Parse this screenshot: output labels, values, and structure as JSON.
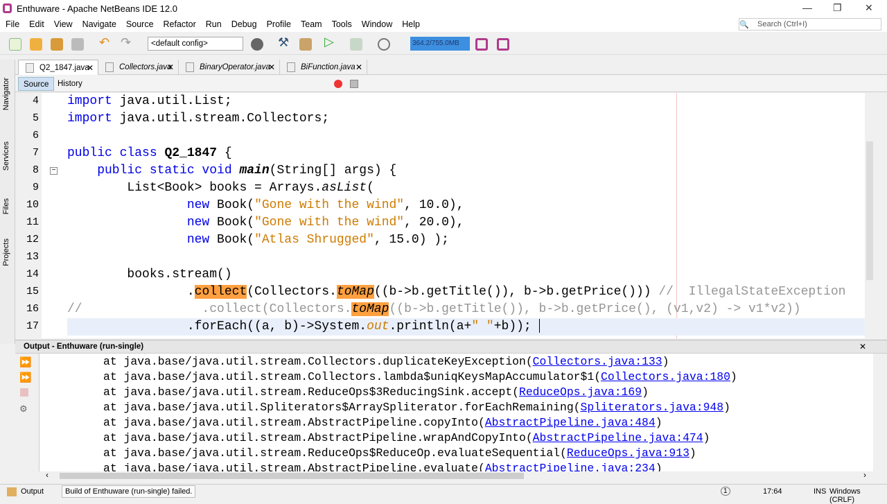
{
  "window": {
    "title": "Enthuware - Apache NetBeans IDE 12.0",
    "minimize": "—",
    "maximize": "❐",
    "close": "✕"
  },
  "menu": [
    "File",
    "Edit",
    "View",
    "Navigate",
    "Source",
    "Refactor",
    "Run",
    "Debug",
    "Profile",
    "Team",
    "Tools",
    "Window",
    "Help"
  ],
  "search": {
    "placeholder": "Search (Ctrl+I)"
  },
  "toolbar": {
    "config": "<default config>",
    "memory": "364.2/755.0MB"
  },
  "tabs": [
    {
      "label": "Q2_1847.java",
      "active": true
    },
    {
      "label": "Collectors.java"
    },
    {
      "label": "BinaryOperator.java"
    },
    {
      "label": "BiFunction.java"
    }
  ],
  "editor_toolbar": {
    "source": "Source",
    "history": "History"
  },
  "side_nav": [
    "Navigator",
    "Services",
    "Files",
    "Projects"
  ],
  "code": [
    {
      "n": "4",
      "seg": [
        [
          "import ",
          "kw"
        ],
        [
          "java.util.List;",
          ""
        ]
      ]
    },
    {
      "n": "5",
      "seg": [
        [
          "import ",
          "kw"
        ],
        [
          "java.util.stream.Collectors;",
          ""
        ]
      ]
    },
    {
      "n": "6",
      "seg": []
    },
    {
      "n": "7",
      "seg": [
        [
          "public class ",
          "kw"
        ],
        [
          "Q2_1847",
          "bold"
        ],
        [
          " {",
          ""
        ]
      ]
    },
    {
      "n": "8",
      "seg": [
        [
          "    public static void ",
          "kw"
        ],
        [
          "main",
          "bold it"
        ],
        [
          "(String[] args) {",
          ""
        ]
      ]
    },
    {
      "n": "9",
      "seg": [
        [
          "        List<Book> books = Arrays.",
          ""
        ],
        [
          "asList",
          "it"
        ],
        [
          "(",
          ""
        ]
      ]
    },
    {
      "n": "10",
      "seg": [
        [
          "                new ",
          "kw"
        ],
        [
          "Book(",
          ""
        ],
        [
          "\"Gone with the wind\"",
          "str"
        ],
        [
          ", 10.0),",
          ""
        ]
      ]
    },
    {
      "n": "11",
      "seg": [
        [
          "                new ",
          "kw"
        ],
        [
          "Book(",
          ""
        ],
        [
          "\"Gone with the wind\"",
          "str"
        ],
        [
          ", 20.0),",
          ""
        ]
      ]
    },
    {
      "n": "12",
      "seg": [
        [
          "                new ",
          "kw"
        ],
        [
          "Book(",
          ""
        ],
        [
          "\"Atlas Shrugged\"",
          "str"
        ],
        [
          ", 15.0) );",
          ""
        ]
      ]
    },
    {
      "n": "13",
      "seg": []
    },
    {
      "n": "14",
      "seg": [
        [
          "        books.stream()",
          ""
        ]
      ]
    },
    {
      "n": "15",
      "seg": [
        [
          "                .",
          ""
        ],
        [
          "collect",
          "hl"
        ],
        [
          "(Collectors.",
          ""
        ],
        [
          "toMap",
          "hl it"
        ],
        [
          "((b->b.getTitle()), b->b.getPrice())) ",
          ""
        ],
        [
          "//  IllegalStateException",
          "cm"
        ]
      ]
    },
    {
      "n": "16",
      "seg": [
        [
          "//                .collect(Collectors.",
          "cm"
        ],
        [
          "toMap",
          "hl it"
        ],
        [
          "((b->b.getTitle()), b->b.getPrice(), (v1,v2) -> v1*v2))",
          "cm"
        ]
      ]
    },
    {
      "n": "17",
      "seg": [
        [
          "                .forEach((a, b)->System.",
          ""
        ],
        [
          "out",
          "it str"
        ],
        [
          ".println(a+",
          ""
        ],
        [
          "\" \"",
          "str"
        ],
        [
          "+b)); ",
          ""
        ]
      ],
      "current": true
    }
  ],
  "output": {
    "title": "Output - Enthuware (run-single)",
    "lines": [
      [
        "at java.base/java.util.stream.Collectors.duplicateKeyException(",
        "Collectors.java:133",
        ")"
      ],
      [
        "at java.base/java.util.stream.Collectors.lambda$uniqKeysMapAccumulator$1(",
        "Collectors.java:180",
        ")"
      ],
      [
        "at java.base/java.util.stream.ReduceOps$3ReducingSink.accept(",
        "ReduceOps.java:169",
        ")"
      ],
      [
        "at java.base/java.util.Spliterators$ArraySpliterator.forEachRemaining(",
        "Spliterators.java:948",
        ")"
      ],
      [
        "at java.base/java.util.stream.AbstractPipeline.copyInto(",
        "AbstractPipeline.java:484",
        ")"
      ],
      [
        "at java.base/java.util.stream.AbstractPipeline.wrapAndCopyInto(",
        "AbstractPipeline.java:474",
        ")"
      ],
      [
        "at java.base/java.util.stream.ReduceOps$ReduceOp.evaluateSequential(",
        "ReduceOps.java:913",
        ")"
      ],
      [
        "at java.base/java.util.stream.AbstractPipeline.evaluate(",
        "AbstractPipeline.java:234",
        ")"
      ]
    ]
  },
  "status": {
    "output_tab": "Output",
    "message": "Build of Enthuware (run-single) failed.",
    "notifications": "1",
    "position": "17:64",
    "mode": "INS",
    "line_ending": "Windows (CRLF)"
  },
  "colors": {
    "memory_bar": "#3d8fe0",
    "highlight": "#ffa040",
    "keyword": "#0000e6",
    "string": "#ce7b00"
  }
}
